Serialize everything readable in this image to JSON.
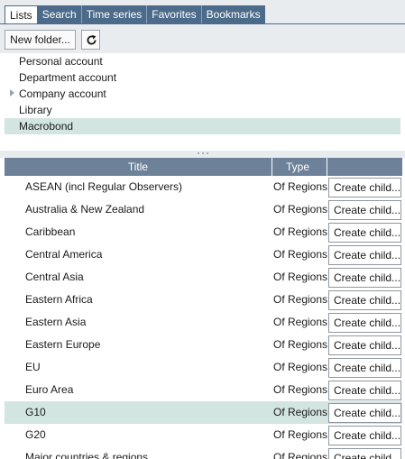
{
  "tabs": [
    {
      "label": "Lists",
      "active": true
    },
    {
      "label": "Search",
      "active": false
    },
    {
      "label": "Time series",
      "active": false
    },
    {
      "label": "Favorites",
      "active": false
    },
    {
      "label": "Bookmarks",
      "active": false
    }
  ],
  "toolbar": {
    "new_folder_label": "New folder...",
    "refresh_icon": "refresh-icon"
  },
  "tree": {
    "items": [
      {
        "label": "Personal account",
        "expandable": false,
        "selected": false
      },
      {
        "label": "Department account",
        "expandable": false,
        "selected": false
      },
      {
        "label": "Company account",
        "expandable": true,
        "selected": false
      },
      {
        "label": "Library",
        "expandable": false,
        "selected": false
      },
      {
        "label": "Macrobond",
        "expandable": false,
        "selected": true
      }
    ]
  },
  "grid": {
    "columns": {
      "title": "Title",
      "type": "Type"
    },
    "rows": [
      {
        "title": "ASEAN (incl Regular Observers)",
        "type": "Of Regions",
        "action": "Create child..."
      },
      {
        "title": "Australia & New Zealand",
        "type": "Of Regions",
        "action": "Create child..."
      },
      {
        "title": "Caribbean",
        "type": "Of Regions",
        "action": "Create child..."
      },
      {
        "title": "Central America",
        "type": "Of Regions",
        "action": "Create child..."
      },
      {
        "title": "Central Asia",
        "type": "Of Regions",
        "action": "Create child..."
      },
      {
        "title": "Eastern Africa",
        "type": "Of Regions",
        "action": "Create child..."
      },
      {
        "title": "Eastern Asia",
        "type": "Of Regions",
        "action": "Create child..."
      },
      {
        "title": "Eastern Europe",
        "type": "Of Regions",
        "action": "Create child..."
      },
      {
        "title": "EU",
        "type": "Of Regions",
        "action": "Create child..."
      },
      {
        "title": "Euro Area",
        "type": "Of Regions",
        "action": "Create child..."
      },
      {
        "title": "G10",
        "type": "Of Regions",
        "action": "Create child...",
        "selected": true
      },
      {
        "title": "G20",
        "type": "Of Regions",
        "action": "Create child..."
      },
      {
        "title": "Major countries & regions",
        "type": "Of Regions",
        "action": "Create child..."
      }
    ]
  },
  "colors": {
    "tab_bar": "#4c6a8a",
    "header": "#6d8199",
    "selection": "#d3e5e1",
    "panel": "#e9ecef"
  }
}
